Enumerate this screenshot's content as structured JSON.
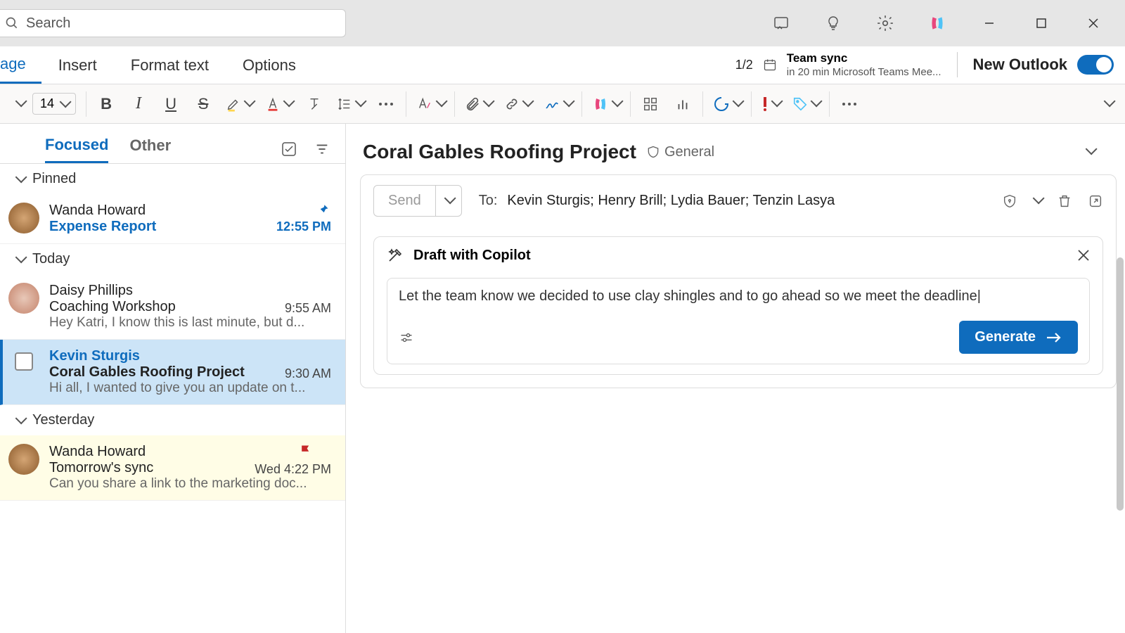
{
  "titlebar": {
    "search_placeholder": "Search"
  },
  "menubar": {
    "tabs": [
      "age",
      "Insert",
      "Format text",
      "Options"
    ],
    "page_count": "1/2",
    "event": {
      "title": "Team sync",
      "subtitle": "in 20 min Microsoft Teams Mee..."
    },
    "new_outlook": "New Outlook"
  },
  "toolbar": {
    "font_size": "14"
  },
  "mail_list": {
    "tabs": {
      "focused": "Focused",
      "other": "Other"
    },
    "sections": {
      "pinned": "Pinned",
      "today": "Today",
      "yesterday": "Yesterday"
    },
    "items": [
      {
        "sender": "Wanda Howard",
        "subject": "Expense Report",
        "time": "12:55 PM"
      },
      {
        "sender": "Daisy Phillips",
        "subject": "Coaching Workshop",
        "preview": "Hey Katri, I know this is last minute, but d...",
        "time": "9:55 AM"
      },
      {
        "sender": "Kevin Sturgis",
        "subject": "Coral Gables Roofing Project",
        "preview": "Hi all, I wanted to give you an update on t...",
        "time": "9:30 AM"
      },
      {
        "sender": "Wanda Howard",
        "subject": "Tomorrow's sync",
        "preview": "Can you share a link to the marketing doc...",
        "time": "Wed 4:22 PM"
      }
    ]
  },
  "reading": {
    "title": "Coral Gables Roofing Project",
    "badge": "General",
    "compose": {
      "send": "Send",
      "to_label": "To:",
      "recipients": "Kevin Sturgis; Henry Brill; Lydia Bauer; Tenzin Lasya"
    },
    "copilot": {
      "title": "Draft with Copilot",
      "prompt": "Let the team know we decided to use clay shingles and to go ahead so we meet the deadline|",
      "generate": "Generate"
    }
  }
}
